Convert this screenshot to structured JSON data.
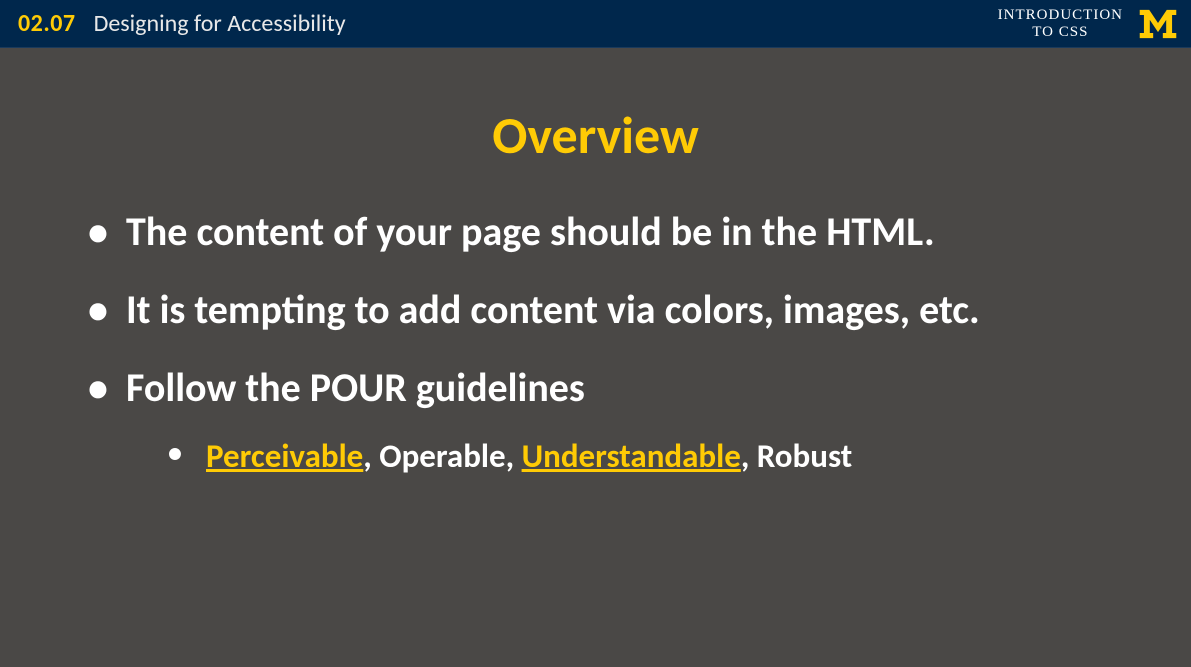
{
  "header": {
    "lecture_number": "02.07",
    "lecture_title": "Designing for Accessibility",
    "course_line1": "INTRODUCTION",
    "course_line2": "TO CSS"
  },
  "slide": {
    "title": "Overview",
    "bullets": [
      {
        "text": "The content of your page should be in the HTML."
      },
      {
        "text": "It is tempting to add content via colors, images, etc."
      },
      {
        "text": "Follow the POUR guidelines",
        "sub": [
          {
            "parts": [
              {
                "text": "Perceivable",
                "highlight": true
              },
              {
                "text": ", Operable, ",
                "highlight": false
              },
              {
                "text": "Understandable",
                "highlight": true
              },
              {
                "text": ", Robust",
                "highlight": false
              }
            ]
          }
        ]
      }
    ]
  }
}
